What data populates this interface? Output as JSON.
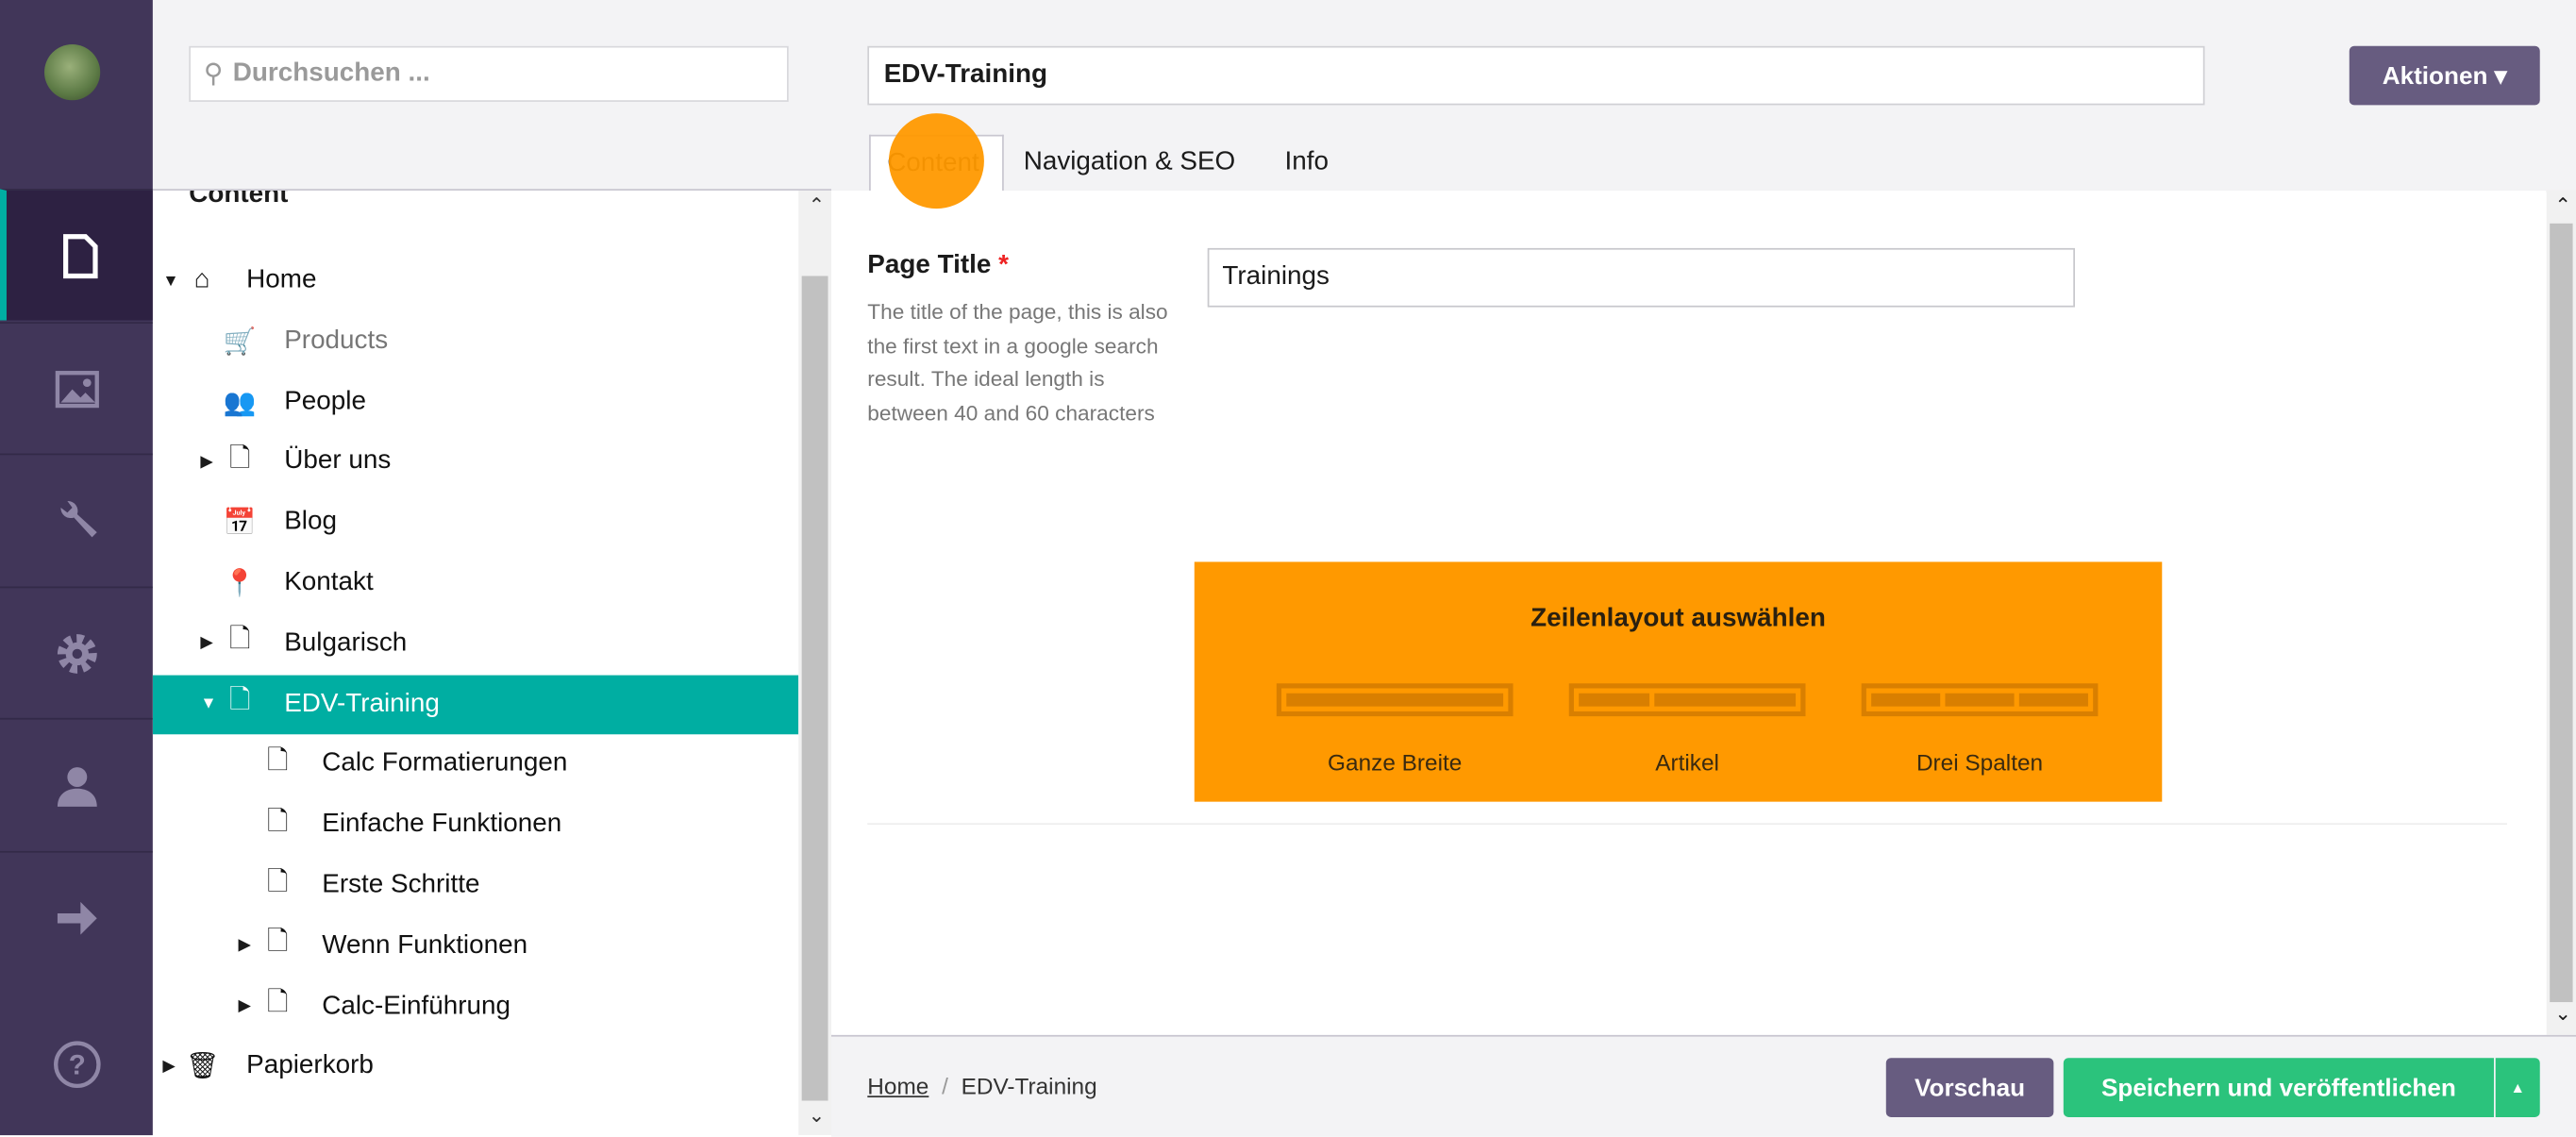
{
  "nav": {
    "items": [
      {
        "icon": "document-icon",
        "label": "Content",
        "active": true
      },
      {
        "icon": "image-icon"
      },
      {
        "icon": "wrench-icon"
      },
      {
        "icon": "gear-icon"
      },
      {
        "icon": "user-icon"
      },
      {
        "icon": "arrow-right-icon"
      },
      {
        "icon": "help-icon"
      }
    ]
  },
  "tree": {
    "search_placeholder": "Durchsuchen ...",
    "section_title": "Content",
    "items": [
      {
        "label": "Home",
        "icon": "home-icon",
        "level": 0,
        "expand": "open"
      },
      {
        "label": "Products",
        "icon": "cart-icon",
        "level": 1,
        "muted": true
      },
      {
        "label": "People",
        "icon": "people-icon",
        "level": 1
      },
      {
        "label": "Über uns",
        "icon": "document-icon",
        "level": 1,
        "expand": "closed"
      },
      {
        "label": "Blog",
        "icon": "calendar-icon",
        "level": 1
      },
      {
        "label": "Kontakt",
        "icon": "map-pin-icon",
        "level": 1
      },
      {
        "label": "Bulgarisch",
        "icon": "document-icon",
        "level": 1,
        "expand": "closed"
      },
      {
        "label": "EDV-Training",
        "icon": "document-icon",
        "level": 1,
        "expand": "open",
        "selected": true
      },
      {
        "label": "Calc Formatierungen",
        "icon": "document-icon",
        "level": 2
      },
      {
        "label": "Einfache Funktionen",
        "icon": "document-icon",
        "level": 2
      },
      {
        "label": "Erste Schritte",
        "icon": "document-icon",
        "level": 2
      },
      {
        "label": "Wenn Funktionen",
        "icon": "document-icon",
        "level": 2,
        "expand": "closed"
      },
      {
        "label": "Calc-Einführung",
        "icon": "document-icon",
        "level": 2,
        "expand": "closed"
      },
      {
        "label": "Papierkorb",
        "icon": "trash-icon",
        "level": 0,
        "expand": "closed"
      }
    ]
  },
  "header": {
    "page_name": "EDV-Training",
    "actions_label": "Aktionen ▾",
    "tabs": [
      {
        "label": "Content",
        "active": true
      },
      {
        "label": "Navigation & SEO"
      },
      {
        "label": "Info"
      }
    ]
  },
  "form": {
    "page_title_label": "Page Title",
    "required_mark": "*",
    "page_title_help": "The title of the page, this is also the first text in a google search result. The ideal length is between 40 and 60 characters",
    "page_title_value": "Trainings"
  },
  "row_layout": {
    "title": "Zeilenlayout auswählen",
    "options": [
      "Ganze Breite",
      "Artikel",
      "Drei Spalten"
    ],
    "color": "#ff9900"
  },
  "footer": {
    "breadcrumb": [
      "Home",
      "EDV-Training"
    ],
    "separator": "/",
    "preview_label": "Vorschau",
    "publish_label": "Speichern und veröffentlichen",
    "caret": "▲"
  },
  "colors": {
    "nav_bg": "#413659",
    "accent_teal": "#00aea2",
    "button_purple": "#675c80",
    "publish_green": "#2bc37c",
    "click_indicator": "#ff9900"
  }
}
